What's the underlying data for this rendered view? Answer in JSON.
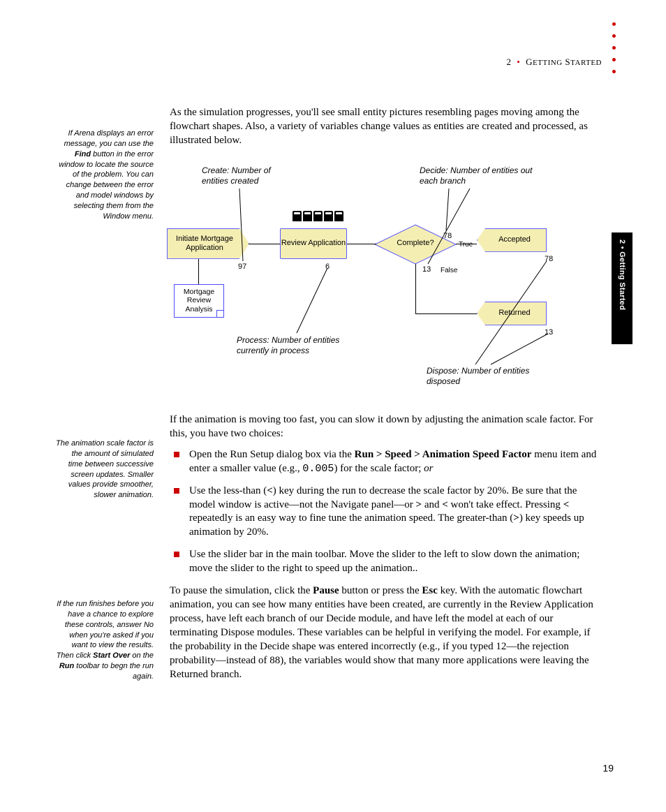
{
  "header": {
    "chapter_num": "2",
    "sep": "•",
    "chapter_title": "Getting Started",
    "side_tab": "2 • Getting Started"
  },
  "margin_notes": {
    "note1": "If Arena displays an error message, you can use the Find button in the error window to locate the source of the problem. You can change between the error and model windows by selecting them from the Window menu.",
    "note2": "The animation scale factor is the amount of simulated time between successive screen updates. Smaller values provide smoother, slower animation.",
    "note3": "If the run finishes before you have a chance to explore these controls, answer No when you're asked if you want to view the results. Then click Start Over on the Run toolbar to begn the run again."
  },
  "body": {
    "p1": "As the simulation progresses, you'll see small entity pictures resembling pages moving among the flowchart shapes. Also, a variety of variables change values as entities are created and processed, as illustrated below.",
    "p2": "If the animation is moving too fast, you can slow it down by adjusting the animation scale factor. For this, you have two choices:",
    "li1_a": "Open the Run Setup dialog box via the ",
    "li1_b": "Run > Speed > Animation Speed Factor",
    "li1_c": " menu item and enter a smaller value (e.g., ",
    "li1_d": "0.005",
    "li1_e": ") for the scale factor; ",
    "li1_f": "or",
    "li2": "Use the less-than (<) key during the run to decrease the scale factor by 20%. Be sure that the model window is active—not the Navigate panel—or > and < won't take effect. Pressing < repeatedly is an easy way to fine tune the animation speed. The greater-than (>) key speeds up animation by 20%.",
    "li3": "Use the slider bar in the main toolbar. Move the slider to the left to slow down the animation; move the slider to the right to speed up the animation..",
    "p3_a": "To pause the simulation, click the ",
    "p3_b": "Pause",
    "p3_c": " button or press the ",
    "p3_d": "Esc",
    "p3_e": " key. With the automatic flowchart animation, you can see how many entities have been created, are currently in the Review Application process, have left each branch of our Decide module, and have left the model at each of our terminating Dispose modules. These variables can be helpful in verifying the model. For example, if the probability in the Decide shape was entered incorrectly (e.g., if you typed 12—the rejection probability—instead of 88), the variables would show that many more applications were leaving the Returned branch."
  },
  "flowchart": {
    "callout_create": "Create: Number of entities created",
    "callout_decide": "Decide: Number of entities out each branch",
    "callout_process": "Process: Number of entities currently in process",
    "callout_dispose": "Dispose: Number of entities disposed",
    "shape_initiate": "Initiate Mortgage Application",
    "shape_review": "Review Application",
    "shape_complete": "Complete?",
    "shape_accepted": "Accepted",
    "shape_returned": "Returned",
    "shape_note": "Mortgage Review Analysis",
    "num_create": "97",
    "num_process": "6",
    "num_true": "78",
    "num_false": "13",
    "num_accepted": "78",
    "num_returned": "13",
    "label_true": "True",
    "label_false": "False"
  },
  "page_number": "19"
}
